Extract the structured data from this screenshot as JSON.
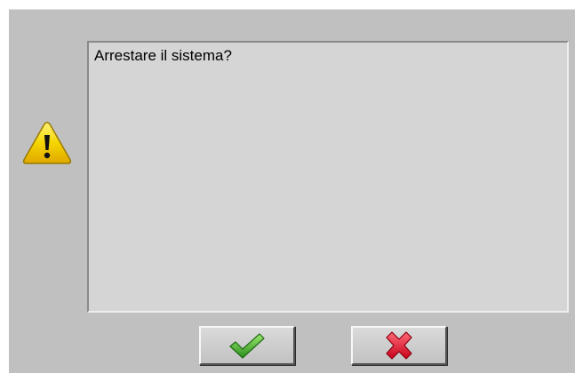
{
  "dialog": {
    "message": "Arrestare il sistema?",
    "icon": "warning-icon",
    "buttons": {
      "confirm_icon": "check-icon",
      "cancel_icon": "cross-icon"
    }
  },
  "colors": {
    "dialog_bg": "#c0c0c0",
    "message_bg": "#d5d5d5",
    "warning_fill": "#f4d300",
    "confirm_green": "#3aa82a",
    "cancel_red": "#e0112b"
  }
}
